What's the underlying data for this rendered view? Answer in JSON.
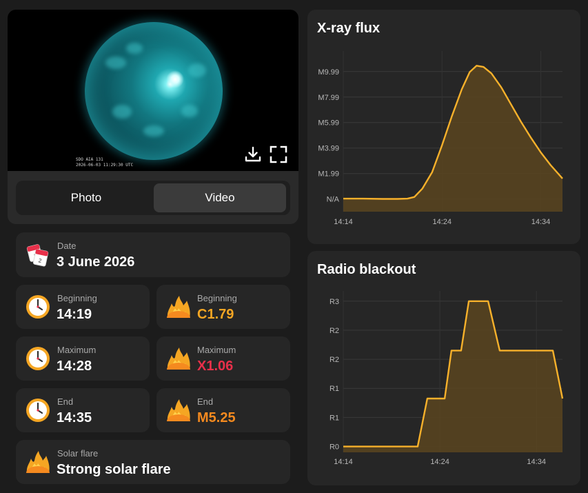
{
  "media": {
    "timestamp_line1": "SDO AIA 131",
    "timestamp_line2": "2026-06-03 11:29:30 UTC",
    "tabs": [
      {
        "label": "Photo",
        "active": false
      },
      {
        "label": "Video",
        "active": true
      }
    ]
  },
  "date_card": {
    "label": "Date",
    "value": "3 June 2026"
  },
  "times": {
    "beginning": {
      "label": "Beginning",
      "value": "14:19"
    },
    "maximum": {
      "label": "Maximum",
      "value": "14:28"
    },
    "end": {
      "label": "End",
      "value": "14:35"
    }
  },
  "classes": {
    "beginning": {
      "label": "Beginning",
      "value": "C1.79",
      "color": "#f5a623"
    },
    "maximum": {
      "label": "Maximum",
      "value": "X1.06",
      "color": "#e8304a"
    },
    "end": {
      "label": "End",
      "value": "M5.25",
      "color": "#f58a1f"
    }
  },
  "solar_flare": {
    "label": "Solar flare",
    "value": "Strong solar flare"
  },
  "icons": [
    "calendar-icon",
    "clock-icon",
    "fire-icon",
    "download-icon",
    "fullscreen-icon"
  ],
  "colors": {
    "accent_line": "#f7b12b",
    "accent_fill": "#5a4520",
    "background": "#1c1c1c",
    "card": "#262626"
  },
  "chart_data": [
    {
      "type": "area",
      "title": "X-ray flux",
      "y_ticks": [
        "N/A",
        "M1.99",
        "M3.99",
        "M5.99",
        "M7.99",
        "M9.99"
      ],
      "y_tick_values": [
        0,
        1.99,
        3.99,
        5.99,
        7.99,
        9.99
      ],
      "x_ticks": [
        "14:14",
        "14:24",
        "14:34"
      ],
      "x_tick_values": [
        0,
        10,
        20
      ],
      "xlim": [
        0,
        22.2
      ],
      "ylim": [
        -1.0,
        11.6
      ],
      "x": [
        0,
        2,
        4,
        5.5,
        6.5,
        7.2,
        8,
        9,
        10,
        11,
        12,
        12.8,
        13.5,
        14.2,
        15,
        16,
        17,
        18,
        19,
        20,
        21,
        22.2
      ],
      "y": [
        0.02,
        0.02,
        0.0,
        0.0,
        0.02,
        0.15,
        0.8,
        2.1,
        4.2,
        6.5,
        8.6,
        9.95,
        10.45,
        10.35,
        9.85,
        8.75,
        7.4,
        6.05,
        4.8,
        3.65,
        2.65,
        1.6
      ],
      "grid": true
    },
    {
      "type": "area",
      "title": "Radio blackout",
      "y_ticks": [
        "R0",
        "R1",
        "R1",
        "R2",
        "R2",
        "R3"
      ],
      "y_tick_values": [
        0,
        1,
        2,
        3,
        4,
        5
      ],
      "x_ticks": [
        "14:14",
        "14:24",
        "14:34"
      ],
      "x_tick_values": [
        0,
        10,
        20
      ],
      "xlim": [
        0,
        22.7
      ],
      "ylim": [
        -0.2,
        5.35
      ],
      "x": [
        0,
        4.5,
        7.7,
        8.7,
        10.5,
        11.2,
        12.2,
        13.0,
        15.0,
        16.2,
        17.5,
        20.0,
        21.7,
        22.7
      ],
      "y": [
        0,
        0,
        0,
        1.65,
        1.65,
        3.3,
        3.3,
        5.0,
        5.0,
        3.3,
        3.3,
        3.3,
        3.3,
        1.65
      ],
      "grid": true
    }
  ]
}
